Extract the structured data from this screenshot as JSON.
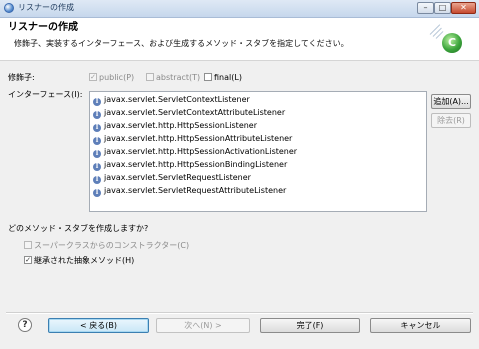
{
  "window": {
    "title": "リスナーの作成",
    "min_glyph": "–",
    "max_glyph": "□",
    "close_glyph": "✕"
  },
  "header": {
    "title": "リスナーの作成",
    "description": "修飾子、実装するインターフェース、および生成するメソッド・スタブを指定してください。",
    "icon_glyph": "C"
  },
  "modifiers": {
    "label": "修飾子:",
    "public": {
      "label": "public(P)",
      "checked": true,
      "enabled": false
    },
    "abstract": {
      "label": "abstract(T)",
      "checked": false,
      "enabled": false
    },
    "final": {
      "label": "final(L)",
      "checked": false,
      "enabled": true
    }
  },
  "interfaces": {
    "label": "インターフェース(I):",
    "icon_glyph": "I",
    "items": [
      "javax.servlet.ServletContextListener",
      "javax.servlet.ServletContextAttributeListener",
      "javax.servlet.http.HttpSessionListener",
      "javax.servlet.http.HttpSessionAttributeListener",
      "javax.servlet.http.HttpSessionActivationListener",
      "javax.servlet.http.HttpSessionBindingListener",
      "javax.servlet.ServletRequestListener",
      "javax.servlet.ServletRequestAttributeListener"
    ],
    "add_label": "追加(A)...",
    "remove_label": "除去(R)"
  },
  "stubs": {
    "question": "どのメソッド・スタブを作成しますか?",
    "superclass_ctor": {
      "label": "スーパークラスからのコンストラクター(C)",
      "checked": false,
      "enabled": false
    },
    "inherited_abstract": {
      "label": "継承された抽象メソッド(H)",
      "checked": true,
      "enabled": true
    }
  },
  "footer": {
    "help_glyph": "?",
    "back_label": "< 戻る(B)",
    "next_label": "次へ(N) >",
    "finish_label": "完了(F)",
    "cancel_label": "キャンセル"
  },
  "colors": {
    "accent": "#3c7fb1",
    "titlebar": "#c6d7ec",
    "interface_icon": "#5e7fb9",
    "wizard_icon": "#3ca53c"
  }
}
